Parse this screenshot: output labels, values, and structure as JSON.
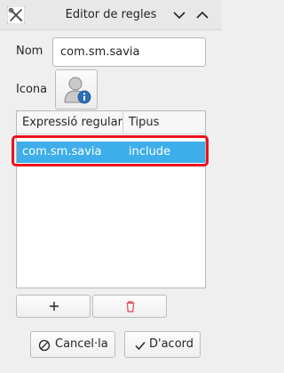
{
  "window": {
    "title": "Editor de regles"
  },
  "form": {
    "name_label": "Nom",
    "name_value": "com.sm.savia",
    "icon_label": "Icona"
  },
  "table": {
    "columns": [
      "Expressió regular",
      "Tipus"
    ],
    "rows": [
      {
        "regex": "com.sm.savia",
        "type": "include",
        "selected": true
      }
    ]
  },
  "buttons": {
    "add_symbol": "+",
    "cancel_label": "Cancel·la",
    "ok_label": "D'acord"
  },
  "colors": {
    "selection": "#3daee9",
    "highlight_outline": "#e8141f",
    "delete_icon": "#da4453"
  },
  "icons": {
    "app": "wrench-screwdriver-icon",
    "minimize": "chevron-down-icon",
    "maximize": "chevron-up-icon",
    "identity": "user-info-icon",
    "add": "plus-icon",
    "delete": "trash-icon",
    "cancel": "cancel-icon",
    "ok": "checkmark-icon"
  }
}
